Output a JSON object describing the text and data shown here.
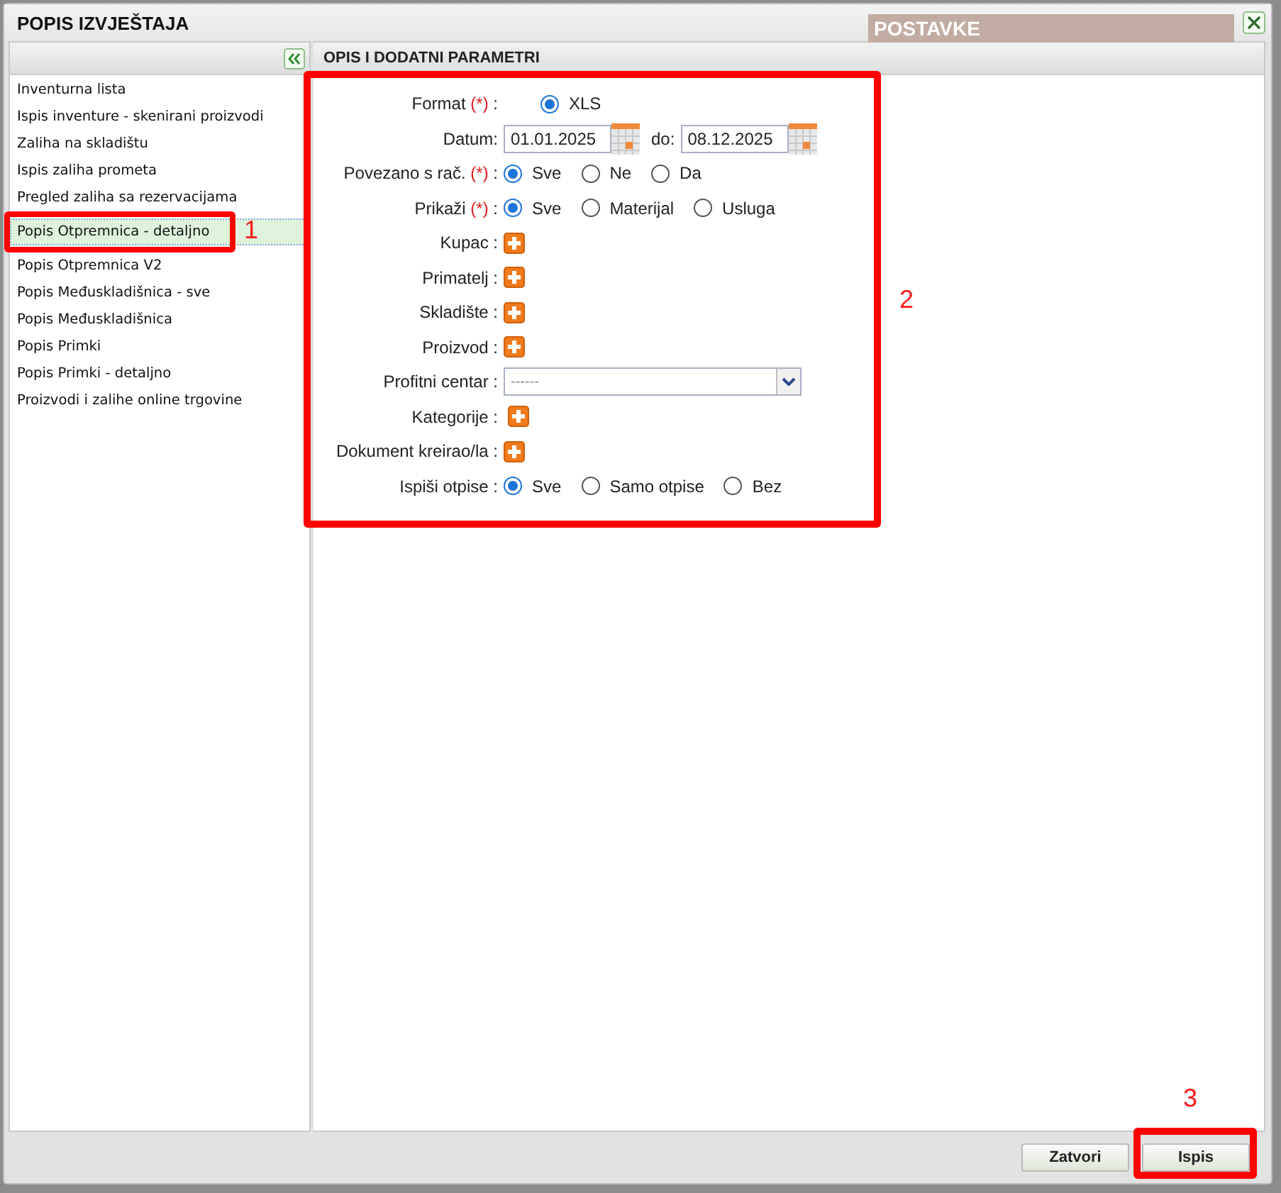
{
  "background": {
    "panel_title": "POSTAVKE"
  },
  "dialog": {
    "title": "POPIS IZVJEŠTAJA"
  },
  "sidebar": {
    "annotation": "1",
    "items": [
      {
        "label": "Inventurna lista",
        "selected": false
      },
      {
        "label": "Ispis inventure - skenirani proizvodi",
        "selected": false
      },
      {
        "label": "Zaliha na skladištu",
        "selected": false
      },
      {
        "label": "Ispis zaliha prometa",
        "selected": false
      },
      {
        "label": "Pregled zaliha sa rezervacijama",
        "selected": false
      },
      {
        "label": "Popis Otpremnica - detaljno",
        "selected": true
      },
      {
        "label": "Popis Otpremnica V2",
        "selected": false
      },
      {
        "label": "Popis Međuskladišnica - sve",
        "selected": false
      },
      {
        "label": "Popis Međuskladišnica",
        "selected": false
      },
      {
        "label": "Popis Primki",
        "selected": false
      },
      {
        "label": "Popis Primki - detaljno",
        "selected": false
      },
      {
        "label": "Proizvodi i zalihe online trgovine",
        "selected": false
      }
    ]
  },
  "panel": {
    "title": "OPIS I DODATNI PARAMETRI",
    "annotation": "2",
    "fields": [
      {
        "kind": "radio",
        "label": "Format",
        "required_mark": "(*)",
        "label_end": ":",
        "options": [
          {
            "label": "XLS",
            "selected": true
          }
        ]
      },
      {
        "kind": "daterange",
        "label": "Datum:",
        "from": "01.01.2025",
        "to_label": "do:",
        "to": "08.12.2025"
      },
      {
        "kind": "radio",
        "label": "Povezano s rač.",
        "required_mark": "(*)",
        "label_end": ":",
        "options": [
          {
            "label": "Sve",
            "selected": true
          },
          {
            "label": "Ne",
            "selected": false
          },
          {
            "label": "Da",
            "selected": false
          }
        ]
      },
      {
        "kind": "radio",
        "label": "Prikaži",
        "required_mark": "(*)",
        "label_end": ":",
        "options": [
          {
            "label": "Sve",
            "selected": true
          },
          {
            "label": "Materijal",
            "selected": false
          },
          {
            "label": "Usluga",
            "selected": false
          }
        ]
      },
      {
        "kind": "add",
        "label": "Kupac :"
      },
      {
        "kind": "add",
        "label": "Primatelj :"
      },
      {
        "kind": "add",
        "label": "Skladište :"
      },
      {
        "kind": "add",
        "label": "Proizvod :"
      },
      {
        "kind": "select",
        "label": "Profitni centar :",
        "value": "------"
      },
      {
        "kind": "add",
        "label": "Kategorije :"
      },
      {
        "kind": "add",
        "label": "Dokument kreirao/la :"
      },
      {
        "kind": "radio",
        "label": "Ispiši otpise :",
        "options": [
          {
            "label": "Sve",
            "selected": true
          },
          {
            "label": "Samo otpise",
            "selected": false
          },
          {
            "label": "Bez",
            "selected": false
          }
        ]
      }
    ]
  },
  "buttons": [
    {
      "label": "Zatvori"
    },
    {
      "label": "Ispis",
      "annotation": "3"
    }
  ]
}
